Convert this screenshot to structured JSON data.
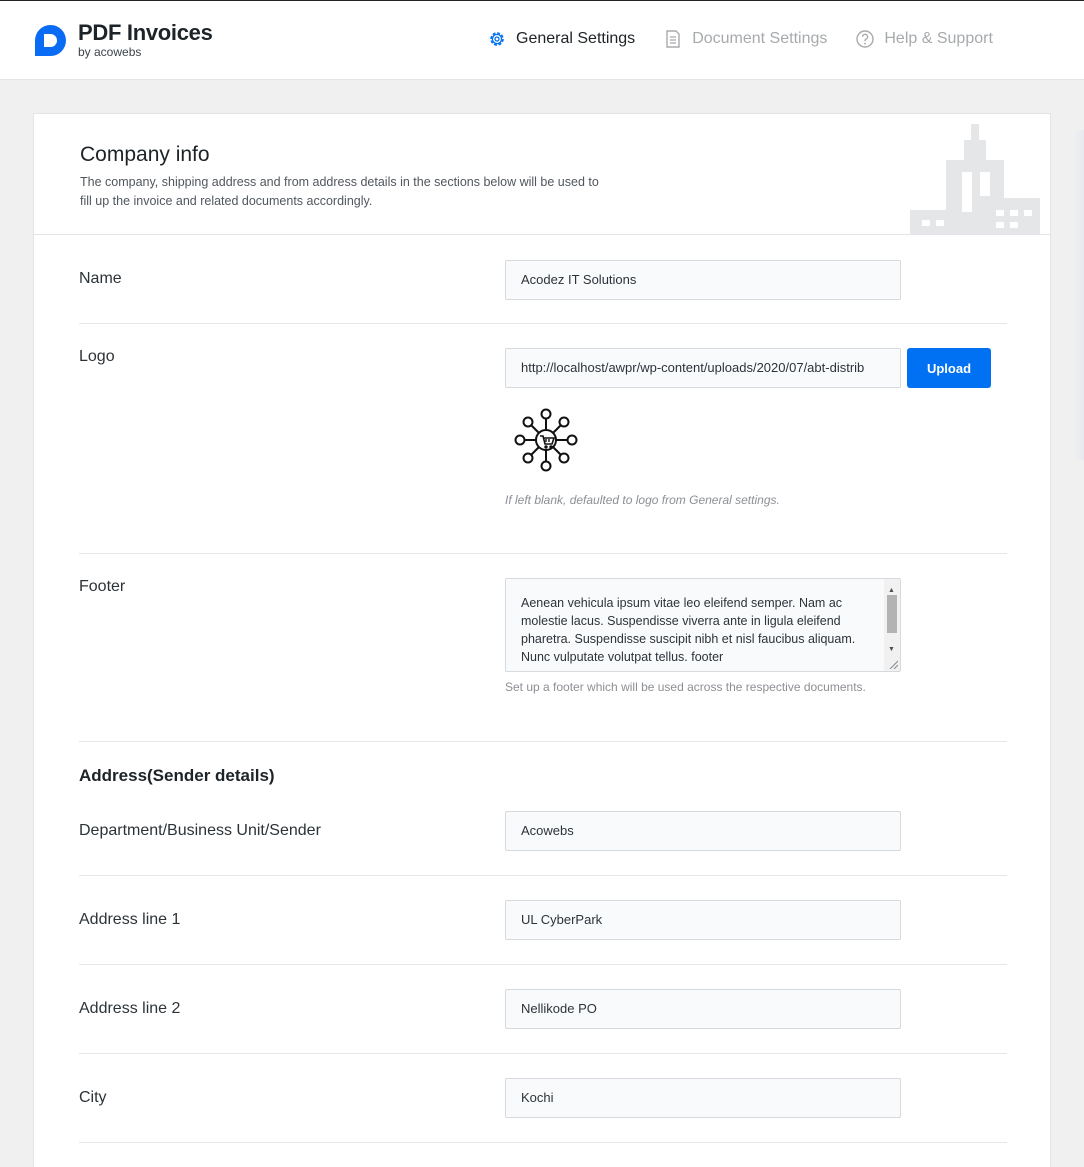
{
  "header": {
    "brand_title": "PDF Invoices",
    "brand_sub": "by acowebs",
    "nav": [
      {
        "label": "General Settings",
        "icon": "gear-icon",
        "active": true
      },
      {
        "label": "Document Settings",
        "icon": "document-icon",
        "active": false
      },
      {
        "label": "Help & Support",
        "icon": "help-icon",
        "active": false
      }
    ]
  },
  "company": {
    "title": "Company info",
    "description": "The company, shipping address and from address details in the sections below will be used to fill up the invoice and related documents accordingly.",
    "name_label": "Name",
    "name_value": "Acodez IT Solutions",
    "logo_label": "Logo",
    "logo_value": "http://localhost/awpr/wp-content/uploads/2020/07/abt-distrib",
    "upload_label": "Upload",
    "logo_hint": "If left blank, defaulted to logo from General settings.",
    "footer_label": "Footer",
    "footer_value": "Aenean vehicula ipsum vitae leo eleifend semper. Nam ac molestie lacus. Suspendisse viverra ante in ligula eleifend pharetra. Suspendisse suscipit nibh et nisl faucibus aliquam. Nunc vulputate volutpat tellus. footer",
    "footer_hint": "Set up a footer which will be used across the respective documents."
  },
  "address": {
    "title": "Address(Sender details)",
    "department_label": "Department/Business Unit/Sender",
    "department_value": "Acowebs",
    "line1_label": "Address line 1",
    "line1_value": "UL CyberPark",
    "line2_label": "Address line 2",
    "line2_value": "Nellikode PO",
    "city_label": "City",
    "city_value": "Kochi"
  },
  "colors": {
    "accent": "#0071f2",
    "brand": "#0a6cf5",
    "illustration": "#e5e6e8"
  }
}
